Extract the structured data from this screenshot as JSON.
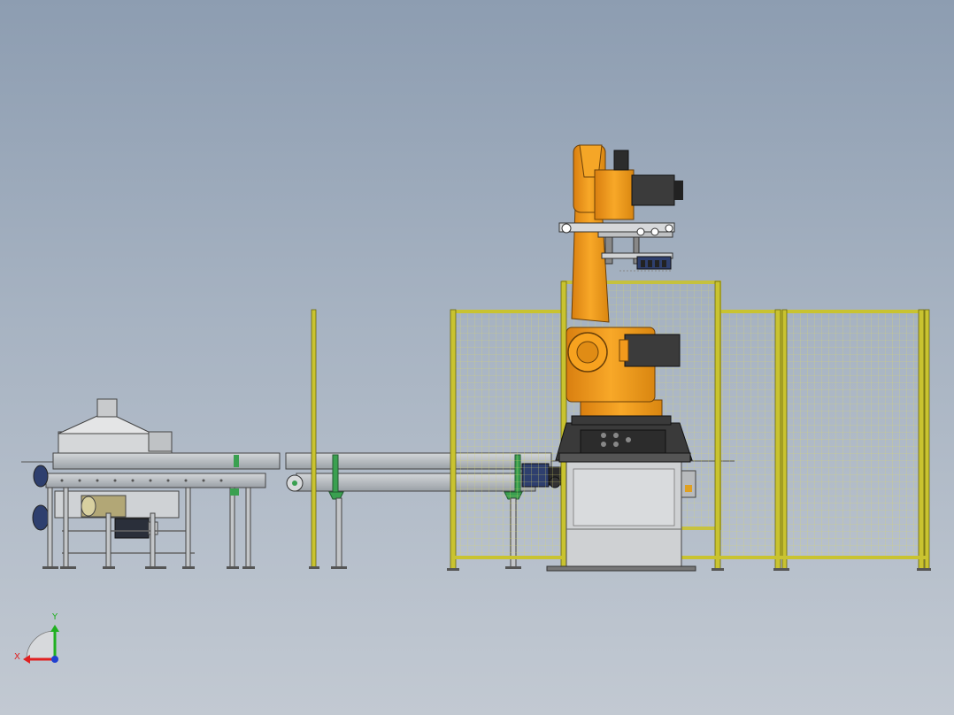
{
  "viewport": {
    "background_top": "#8d9db1",
    "background_bottom": "#c2c9d2"
  },
  "triad": {
    "x_label": "X",
    "y_label": "Y",
    "x_color": "#e02020",
    "y_color": "#20b020",
    "z_color": "#2040d0"
  },
  "colors": {
    "robot_orange": "#f29a1c",
    "robot_dark": "#3a3a3a",
    "fence_frame": "#c9c330",
    "fence_mesh": "#d8d66a",
    "steel": "#b8bcc0",
    "steel_dark": "#6c7076",
    "motor_blue": "#2e3f6e",
    "mount_green": "#3aa050"
  },
  "icons": {
    "robot": "industrial-robot-icon",
    "fence": "safety-fence-icon",
    "conveyor": "conveyor-icon",
    "machine": "processing-machine-icon",
    "triad": "coordinate-triad-icon"
  }
}
